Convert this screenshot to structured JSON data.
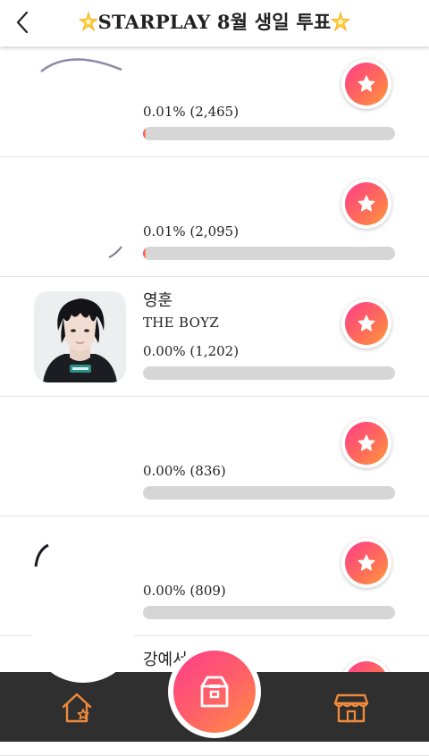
{
  "header": {
    "title": "STARPLAY 8월 생일 투표",
    "back_icon": "chevron-left-icon",
    "sparkle_icon": "sparkle-star-icon"
  },
  "candidates": [
    {
      "name": "",
      "group": "",
      "percent_text": "0.01% (2,465)",
      "progress": 0.01
    },
    {
      "name": "",
      "group": "",
      "percent_text": "0.01% (2,095)",
      "progress": 0.01
    },
    {
      "name": "영훈",
      "group": "THE BOYZ",
      "percent_text": "0.00% (1,202)",
      "progress": 0.0
    },
    {
      "name": "",
      "group": "",
      "percent_text": "0.00% (836)",
      "progress": 0.0
    },
    {
      "name": "",
      "group": "",
      "percent_text": "0.00% (809)",
      "progress": 0.0
    },
    {
      "name": "강예서",
      "group": "",
      "percent_text": "",
      "progress": 0.0
    }
  ],
  "vote_icon": "star-icon",
  "bottom_nav": {
    "home_icon": "home-star-icon",
    "center_icon": "ballot-box-icon",
    "shop_icon": "store-icon"
  },
  "colors": {
    "accent_pink": "#ff3d8b",
    "accent_orange": "#ff8f3f",
    "nav_bg": "#2f2f2f",
    "nav_icon": "#f08a3c",
    "bar_bg": "#d6d6d6"
  }
}
